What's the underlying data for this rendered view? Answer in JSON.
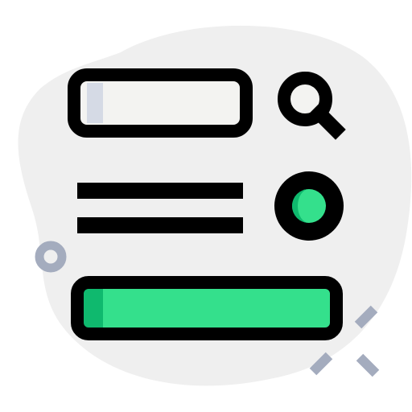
{
  "colors": {
    "blob": "#efefef",
    "outline": "#000000",
    "input_fill": "#f3f3f1",
    "input_shade": "#d5dae5",
    "accent_green": "#34e08c",
    "accent_green_dark": "#0fb96e",
    "sparkle": "#a4acbe",
    "ring": "#a4acbe"
  },
  "icons": {
    "search": "search-icon",
    "menu": "menu-lines-icon",
    "radio": "radio-button-icon",
    "sparkle": "sparkle-icon",
    "ring": "ring-icon"
  }
}
